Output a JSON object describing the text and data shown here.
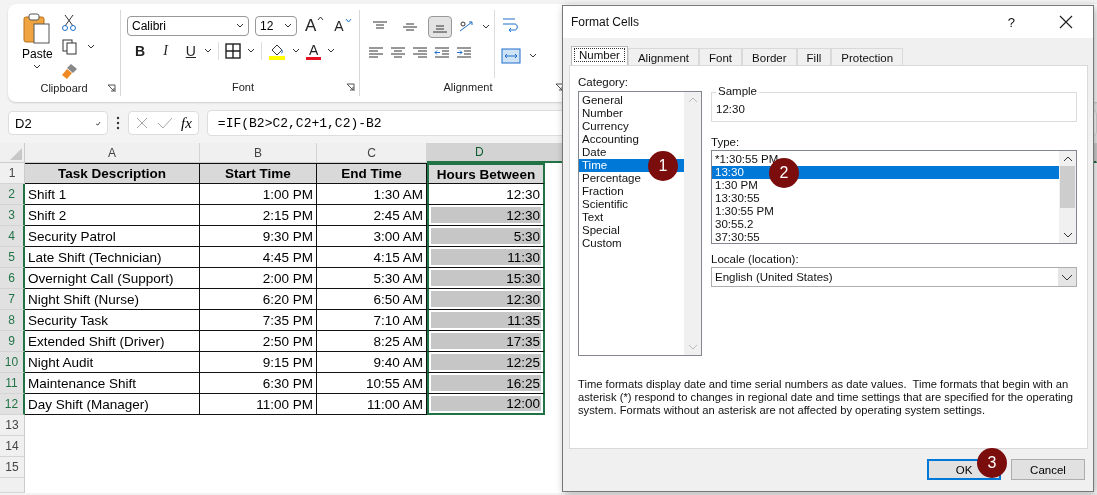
{
  "ribbon": {
    "clipboard": {
      "label": "Clipboard",
      "paste": "Paste"
    },
    "font": {
      "label": "Font",
      "family": "Calibri",
      "size": "12",
      "grow": "A",
      "shrink": "A",
      "bold": "B",
      "italic": "I",
      "underline": "U",
      "font_color": "A"
    },
    "alignment": {
      "label": "Alignment",
      "vertical": [
        {
          "kind": "top",
          "selected": false
        },
        {
          "kind": "middle",
          "selected": false
        },
        {
          "kind": "bottom",
          "selected": true
        }
      ]
    }
  },
  "formula_bar": {
    "name_box": "D2",
    "fx": "fx",
    "formula": "=IF(B2>C2,C2+1,C2)-B2"
  },
  "sheet": {
    "columns": [
      {
        "label": "A",
        "selected": false
      },
      {
        "label": "B",
        "selected": false
      },
      {
        "label": "C",
        "selected": false
      },
      {
        "label": "D",
        "selected": true
      }
    ],
    "header_row": {
      "number": "1",
      "selected": false,
      "cells": [
        "Task Description",
        "Start Time",
        "End Time",
        "Hours Between"
      ]
    },
    "rows": [
      {
        "number": "2",
        "selected": true,
        "task": "Shift 1",
        "start": "1:00 PM",
        "end": "1:30 AM",
        "hours": "12:30",
        "active": true
      },
      {
        "number": "3",
        "selected": true,
        "task": "Shift 2",
        "start": "2:15 PM",
        "end": "2:45 AM",
        "hours": "12:30",
        "active": false
      },
      {
        "number": "4",
        "selected": true,
        "task": "Security Patrol",
        "start": "9:30 PM",
        "end": "3:00 AM",
        "hours": "5:30",
        "active": false
      },
      {
        "number": "5",
        "selected": true,
        "task": "Late Shift (Technician)",
        "start": "4:45 PM",
        "end": "4:15 AM",
        "hours": "11:30",
        "active": false
      },
      {
        "number": "6",
        "selected": true,
        "task": "Overnight Call (Support)",
        "start": "2:00 PM",
        "end": "5:30 AM",
        "hours": "15:30",
        "active": false
      },
      {
        "number": "7",
        "selected": true,
        "task": "Night Shift (Nurse)",
        "start": "6:20 PM",
        "end": "6:50 AM",
        "hours": "12:30",
        "active": false
      },
      {
        "number": "8",
        "selected": true,
        "task": "Security Task",
        "start": "7:35 PM",
        "end": "7:10 AM",
        "hours": "11:35",
        "active": false
      },
      {
        "number": "9",
        "selected": true,
        "task": "Extended Shift (Driver)",
        "start": "2:50 PM",
        "end": "8:25 AM",
        "hours": "17:35",
        "active": false
      },
      {
        "number": "10",
        "selected": true,
        "task": "Night Audit",
        "start": "9:15 PM",
        "end": "9:40 AM",
        "hours": "12:25",
        "active": false
      },
      {
        "number": "11",
        "selected": true,
        "task": "Maintenance Shift",
        "start": "6:30 PM",
        "end": "10:55 AM",
        "hours": "16:25",
        "active": false
      },
      {
        "number": "12",
        "selected": true,
        "task": "Day Shift (Manager)",
        "start": "11:00 PM",
        "end": "11:00 AM",
        "hours": "12:00",
        "active": false
      }
    ],
    "empty_rows": [
      "13",
      "14",
      "15"
    ]
  },
  "dialog": {
    "title": "Format Cells",
    "help": "?",
    "tabs": [
      {
        "label": "Number",
        "selected": true
      },
      {
        "label": "Alignment",
        "selected": false
      },
      {
        "label": "Font",
        "selected": false
      },
      {
        "label": "Border",
        "selected": false
      },
      {
        "label": "Fill",
        "selected": false
      },
      {
        "label": "Protection",
        "selected": false
      }
    ],
    "category_label": "Category:",
    "categories": [
      {
        "label": "General",
        "selected": false
      },
      {
        "label": "Number",
        "selected": false
      },
      {
        "label": "Currency",
        "selected": false
      },
      {
        "label": "Accounting",
        "selected": false
      },
      {
        "label": "Date",
        "selected": false
      },
      {
        "label": "Time",
        "selected": true
      },
      {
        "label": "Percentage",
        "selected": false
      },
      {
        "label": "Fraction",
        "selected": false
      },
      {
        "label": "Scientific",
        "selected": false
      },
      {
        "label": "Text",
        "selected": false
      },
      {
        "label": "Special",
        "selected": false
      },
      {
        "label": "Custom",
        "selected": false
      }
    ],
    "sample_label": "Sample",
    "sample": "12:30",
    "type_label": "Type:",
    "types": [
      {
        "label": "*1:30:55 PM",
        "selected": false
      },
      {
        "label": "13:30",
        "selected": true
      },
      {
        "label": "1:30 PM",
        "selected": false
      },
      {
        "label": "13:30:55",
        "selected": false
      },
      {
        "label": "1:30:55 PM",
        "selected": false
      },
      {
        "label": "30:55.2",
        "selected": false
      },
      {
        "label": "37:30:55",
        "selected": false
      }
    ],
    "locale_label": "Locale (location):",
    "locale": "English (United States)",
    "description": "Time formats display date and time serial numbers as date values.  Time formats that begin with an asterisk (*) respond to changes in regional date and time settings that are specified for the operating system. Formats without an asterisk are not affected by operating system settings.",
    "buttons": [
      {
        "label": "OK",
        "default": true
      },
      {
        "label": "Cancel",
        "default": false
      }
    ],
    "callouts": [
      "1",
      "2",
      "3"
    ]
  }
}
